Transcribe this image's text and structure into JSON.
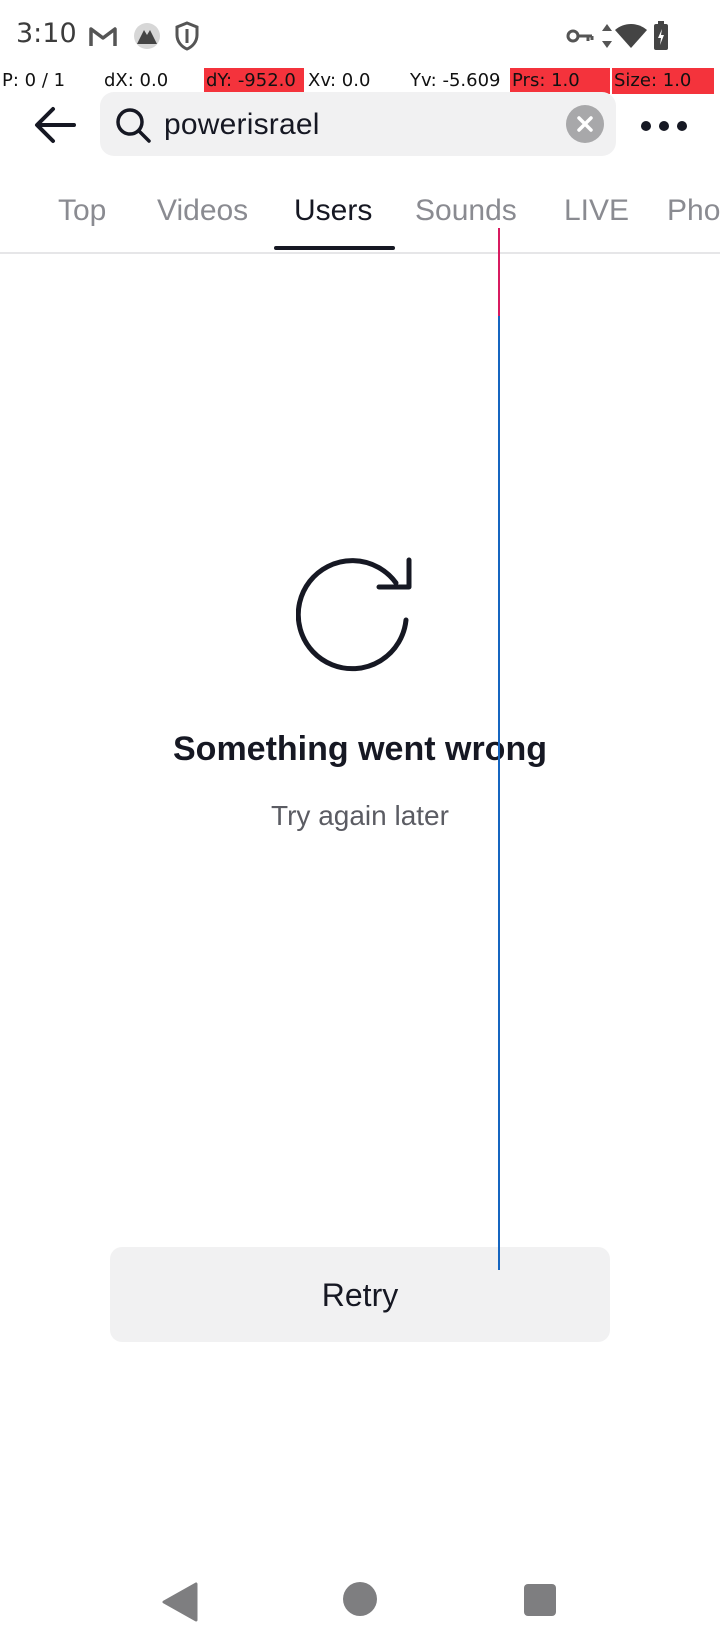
{
  "status_bar": {
    "time": "3:10",
    "left_icons": [
      "gmail-icon",
      "notification-app-icon",
      "shield-icon"
    ],
    "right_icons": [
      "vpn-key-icon",
      "data-arrows-icon",
      "wifi-icon",
      "battery-charging-icon"
    ]
  },
  "debug_overlay": {
    "pointer": "P: 0 / 1",
    "dx": "dX: 0.0",
    "dy": "dY: -952.0",
    "xv": "Xv: 0.0",
    "yv": "Yv: -5.609",
    "prs": "Prs: 1.0",
    "size": "Size: 1.0"
  },
  "header": {
    "back_icon": "arrow-left-icon",
    "search_value": "powerisrael",
    "clear_icon": "close-circle-icon",
    "more_icon": "more-horizontal-icon"
  },
  "tabs": {
    "items": [
      "Top",
      "Videos",
      "Users",
      "Sounds",
      "LIVE",
      "Photos"
    ],
    "active": "Users"
  },
  "error_state": {
    "icon": "refresh-icon",
    "title": "Something went wrong",
    "subtitle": "Try again later",
    "retry_label": "Retry"
  },
  "nav_bar": {
    "icons": [
      "nav-back-icon",
      "nav-home-icon",
      "nav-recents-icon"
    ]
  },
  "colors": {
    "debug_highlight": "#f4333c",
    "trace_line": "#1565c0",
    "trace_start": "#d81b60",
    "text_primary": "#161823",
    "text_secondary": "#8a8b91"
  }
}
